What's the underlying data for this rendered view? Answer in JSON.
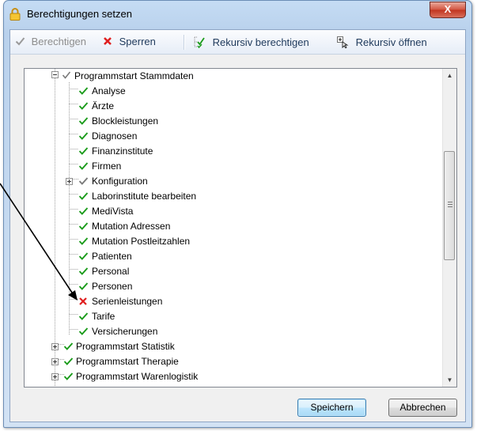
{
  "window": {
    "title": "Berechtigungen setzen",
    "close_glyph": "X"
  },
  "toolbar": {
    "berechtigen": "Berechtigen",
    "sperren": "Sperren",
    "rekursiv_berechtigen": "Rekursiv berechtigen",
    "rekursiv_oeffnen": "Rekursiv öffnen"
  },
  "tree": {
    "root_expanded": "Programmstart Stammdaten",
    "children": [
      {
        "label": "Analyse",
        "state": "allowed"
      },
      {
        "label": "Ärzte",
        "state": "allowed"
      },
      {
        "label": "Blockleistungen",
        "state": "allowed"
      },
      {
        "label": "Diagnosen",
        "state": "allowed"
      },
      {
        "label": "Finanzinstitute",
        "state": "allowed"
      },
      {
        "label": "Firmen",
        "state": "allowed"
      },
      {
        "label": "Konfiguration",
        "state": "partial",
        "expandable": true
      },
      {
        "label": "Laborinstitute bearbeiten",
        "state": "allowed"
      },
      {
        "label": "MediVista",
        "state": "allowed"
      },
      {
        "label": "Mutation Adressen",
        "state": "allowed"
      },
      {
        "label": "Mutation Postleitzahlen",
        "state": "allowed"
      },
      {
        "label": "Patienten",
        "state": "allowed"
      },
      {
        "label": "Personal",
        "state": "allowed"
      },
      {
        "label": "Personen",
        "state": "allowed"
      },
      {
        "label": "Serienleistungen",
        "state": "denied"
      },
      {
        "label": "Tarife",
        "state": "allowed"
      },
      {
        "label": "Versicherungen",
        "state": "allowed"
      }
    ],
    "collapsed_roots": [
      {
        "label": "Programmstart Statistik",
        "state": "allowed"
      },
      {
        "label": "Programmstart Therapie",
        "state": "allowed"
      },
      {
        "label": "Programmstart Warenlogistik",
        "state": "allowed"
      }
    ]
  },
  "buttons": {
    "save": "Speichern",
    "cancel": "Abbrechen"
  },
  "icons": {
    "title": "lock-icon",
    "berechtigen": "checkmark-icon",
    "sperren": "x-cross-icon",
    "rekursiv_berechtigen": "recursive-check-icon",
    "rekursiv_oeffnen": "recursive-open-icon"
  },
  "colors": {
    "allowed": "#1a9b1a",
    "denied": "#e01f1f",
    "partial": "#7a7a7a"
  }
}
